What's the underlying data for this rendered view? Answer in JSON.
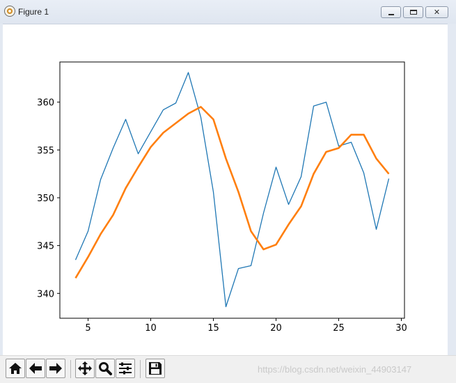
{
  "window": {
    "title": "Figure 1",
    "minimize_icon": "minimize-icon",
    "maximize_icon": "maximize-icon",
    "close_icon": "close-icon"
  },
  "chart_data": {
    "type": "line",
    "title": "",
    "xlabel": "",
    "ylabel": "",
    "xlim": [
      2.75,
      30.25
    ],
    "ylim": [
      337.4,
      364.2
    ],
    "xticks": [
      "5",
      "10",
      "15",
      "20",
      "25",
      "30"
    ],
    "yticks": [
      "340",
      "345",
      "350",
      "355",
      "360"
    ],
    "grid": false,
    "series": [
      {
        "color": "#1f77b4",
        "linewidth": "thin",
        "points": [
          [
            4,
            343.5
          ],
          [
            5,
            346.5
          ],
          [
            6,
            351.9
          ],
          [
            7,
            355.2
          ],
          [
            8,
            358.2
          ],
          [
            9,
            354.6
          ],
          [
            10,
            356.9
          ],
          [
            11,
            359.2
          ],
          [
            12,
            359.9
          ],
          [
            13,
            363.1
          ],
          [
            14,
            358.4
          ],
          [
            15,
            350.6
          ],
          [
            16,
            338.6
          ],
          [
            17,
            342.6
          ],
          [
            18,
            342.9
          ],
          [
            19,
            348.4
          ],
          [
            20,
            353.2
          ],
          [
            21,
            349.3
          ],
          [
            22,
            352.2
          ],
          [
            23,
            359.6
          ],
          [
            24,
            360.0
          ],
          [
            25,
            355.4
          ],
          [
            26,
            355.8
          ],
          [
            27,
            352.6
          ],
          [
            28,
            346.7
          ],
          [
            29,
            352.0
          ]
        ]
      },
      {
        "color": "#ff7f0e",
        "linewidth": "thick",
        "points": [
          [
            4,
            341.6
          ],
          [
            5,
            343.8
          ],
          [
            6,
            346.2
          ],
          [
            7,
            348.2
          ],
          [
            8,
            351.0
          ],
          [
            9,
            353.2
          ],
          [
            10,
            355.3
          ],
          [
            11,
            356.8
          ],
          [
            12,
            357.8
          ],
          [
            13,
            358.8
          ],
          [
            14,
            359.5
          ],
          [
            15,
            358.2
          ],
          [
            16,
            354.1
          ],
          [
            17,
            350.6
          ],
          [
            18,
            346.5
          ],
          [
            19,
            344.6
          ],
          [
            20,
            345.1
          ],
          [
            21,
            347.2
          ],
          [
            22,
            349.1
          ],
          [
            23,
            352.5
          ],
          [
            24,
            354.8
          ],
          [
            25,
            355.2
          ],
          [
            26,
            356.6
          ],
          [
            27,
            356.6
          ],
          [
            28,
            354.1
          ],
          [
            29,
            352.5
          ]
        ]
      }
    ]
  },
  "toolbar": {
    "items": [
      {
        "icon": "home-icon"
      },
      {
        "icon": "back-arrow-icon"
      },
      {
        "icon": "forward-arrow-icon"
      },
      {
        "icon": "pan-move-icon"
      },
      {
        "icon": "zoom-magnifier-icon"
      },
      {
        "icon": "configure-subplots-icon"
      },
      {
        "icon": "save-disk-icon"
      }
    ],
    "watermark": "https://blog.csdn.net/weixin_44903147"
  }
}
